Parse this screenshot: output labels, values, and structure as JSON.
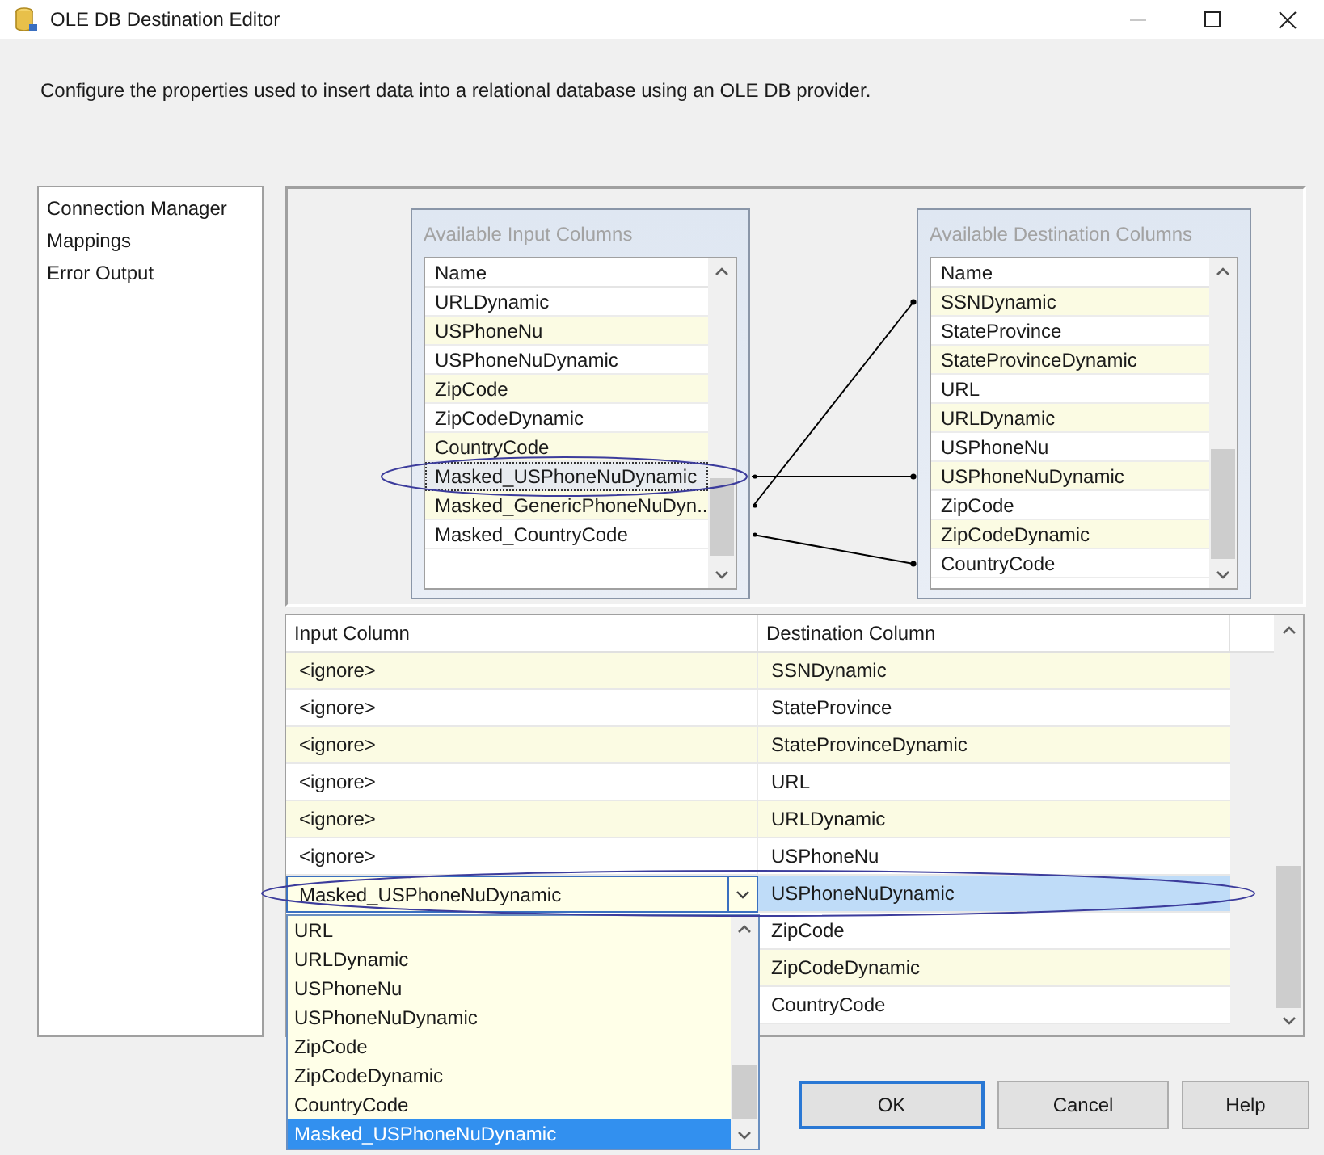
{
  "window": {
    "title": "OLE DB Destination Editor"
  },
  "description": "Configure the properties used to insert data into a relational database using an OLE DB provider.",
  "sidebar": {
    "items": [
      {
        "label": "Connection Manager"
      },
      {
        "label": "Mappings"
      },
      {
        "label": "Error Output"
      }
    ]
  },
  "diagram": {
    "input_columns": {
      "title": "Available Input Columns",
      "header": "Name",
      "items": [
        {
          "label": "URLDynamic",
          "selected": false
        },
        {
          "label": "USPhoneNu",
          "selected": false
        },
        {
          "label": "USPhoneNuDynamic",
          "selected": false
        },
        {
          "label": "ZipCode",
          "selected": false
        },
        {
          "label": "ZipCodeDynamic",
          "selected": false
        },
        {
          "label": "CountryCode",
          "selected": false
        },
        {
          "label": "Masked_USPhoneNuDynamic",
          "selected": true
        },
        {
          "label": "Masked_GenericPhoneNuDyn...",
          "selected": false
        },
        {
          "label": "Masked_CountryCode",
          "selected": false
        }
      ]
    },
    "destination_columns": {
      "title": "Available Destination Columns",
      "header": "Name",
      "items": [
        {
          "label": "SSNDynamic"
        },
        {
          "label": "StateProvince"
        },
        {
          "label": "StateProvinceDynamic"
        },
        {
          "label": "URL"
        },
        {
          "label": "URLDynamic"
        },
        {
          "label": "USPhoneNu"
        },
        {
          "label": "USPhoneNuDynamic"
        },
        {
          "label": "ZipCode"
        },
        {
          "label": "ZipCodeDynamic"
        },
        {
          "label": "CountryCode"
        }
      ]
    }
  },
  "mapping_grid": {
    "columns": [
      "Input Column",
      "Destination Column"
    ],
    "rows": [
      {
        "kind": "text",
        "input": "<ignore>",
        "destination": "SSNDynamic",
        "selected": false
      },
      {
        "kind": "text",
        "input": "<ignore>",
        "destination": "StateProvince",
        "selected": false
      },
      {
        "kind": "text",
        "input": "<ignore>",
        "destination": "StateProvinceDynamic",
        "selected": false
      },
      {
        "kind": "text",
        "input": "<ignore>",
        "destination": "URL",
        "selected": false
      },
      {
        "kind": "text",
        "input": "<ignore>",
        "destination": "URLDynamic",
        "selected": false
      },
      {
        "kind": "text",
        "input": "<ignore>",
        "destination": "USPhoneNu",
        "selected": false
      },
      {
        "kind": "combo",
        "input": "Masked_USPhoneNuDynamic",
        "destination": "USPhoneNuDynamic",
        "selected": true
      },
      {
        "kind": "hidden",
        "destination": "ZipCode",
        "selected": false
      },
      {
        "kind": "hidden",
        "destination": "ZipCodeDynamic",
        "selected": false
      },
      {
        "kind": "hidden",
        "destination": "CountryCode",
        "selected": false
      }
    ]
  },
  "dropdown": {
    "items": [
      {
        "label": "URL",
        "selected": false
      },
      {
        "label": "URLDynamic",
        "selected": false
      },
      {
        "label": "USPhoneNu",
        "selected": false
      },
      {
        "label": "USPhoneNuDynamic",
        "selected": false
      },
      {
        "label": "ZipCode",
        "selected": false
      },
      {
        "label": "ZipCodeDynamic",
        "selected": false
      },
      {
        "label": "CountryCode",
        "selected": false
      },
      {
        "label": "Masked_USPhoneNuDynamic",
        "selected": true
      }
    ]
  },
  "buttons": [
    {
      "label": "OK",
      "default": true
    },
    {
      "label": "Cancel",
      "default": false
    },
    {
      "label": "Help",
      "default": false
    }
  ]
}
